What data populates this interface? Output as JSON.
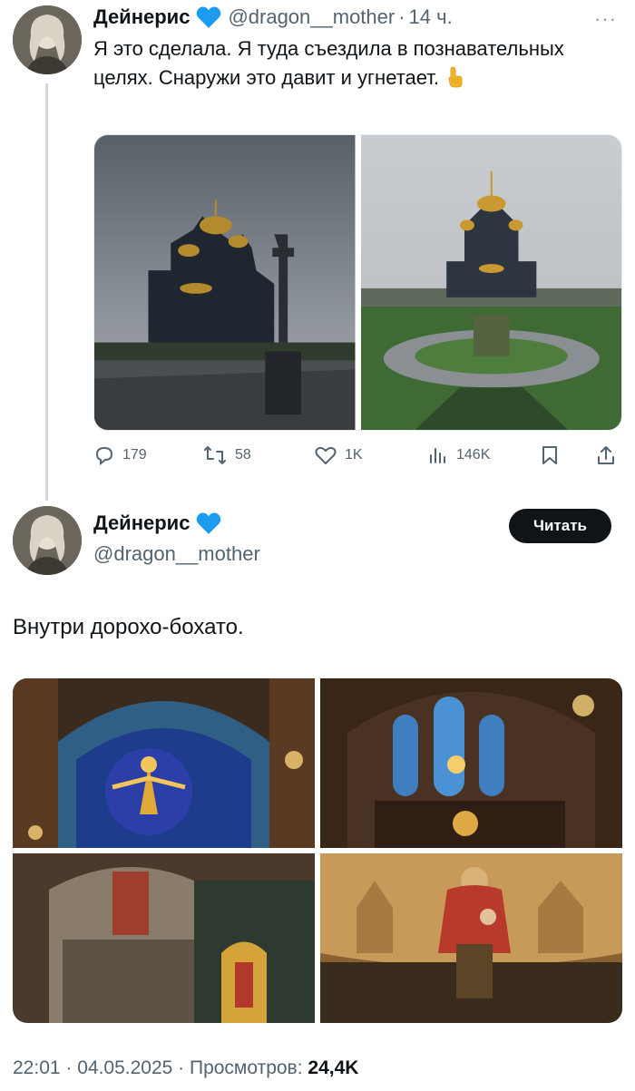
{
  "tweet1": {
    "author_name": "Дейнерис",
    "handle": "@dragon__mother",
    "separator": "·",
    "time": "14 ч.",
    "more": "···",
    "text": "Я это сделала. Я туда съездила в познавательных целях. Снаружи это давит и угнетает.",
    "emoji": "backhand-index-pointing-down",
    "images": [
      "cathedral-exterior-side",
      "cathedral-exterior-front"
    ],
    "replies": "179",
    "reposts": "58",
    "likes": "1K",
    "views": "146K"
  },
  "tweet2": {
    "author_name": "Дейнерис",
    "handle": "@dragon__mother",
    "follow_label": "Читать",
    "text": "Внутри дорохо-бохато.",
    "images": [
      "interior-dome-christ",
      "interior-stained-glass",
      "interior-mosaic-soldiers",
      "interior-mosaic-madonna"
    ],
    "timestamp": "22:01 · 04.05.2025 · Просмотров: ",
    "view_count": "24,4K"
  },
  "colors": {
    "verified": "#1d9bf0",
    "secondary_text": "#536471",
    "button_bg": "#0f1419",
    "thread_line": "#cfd9de"
  }
}
